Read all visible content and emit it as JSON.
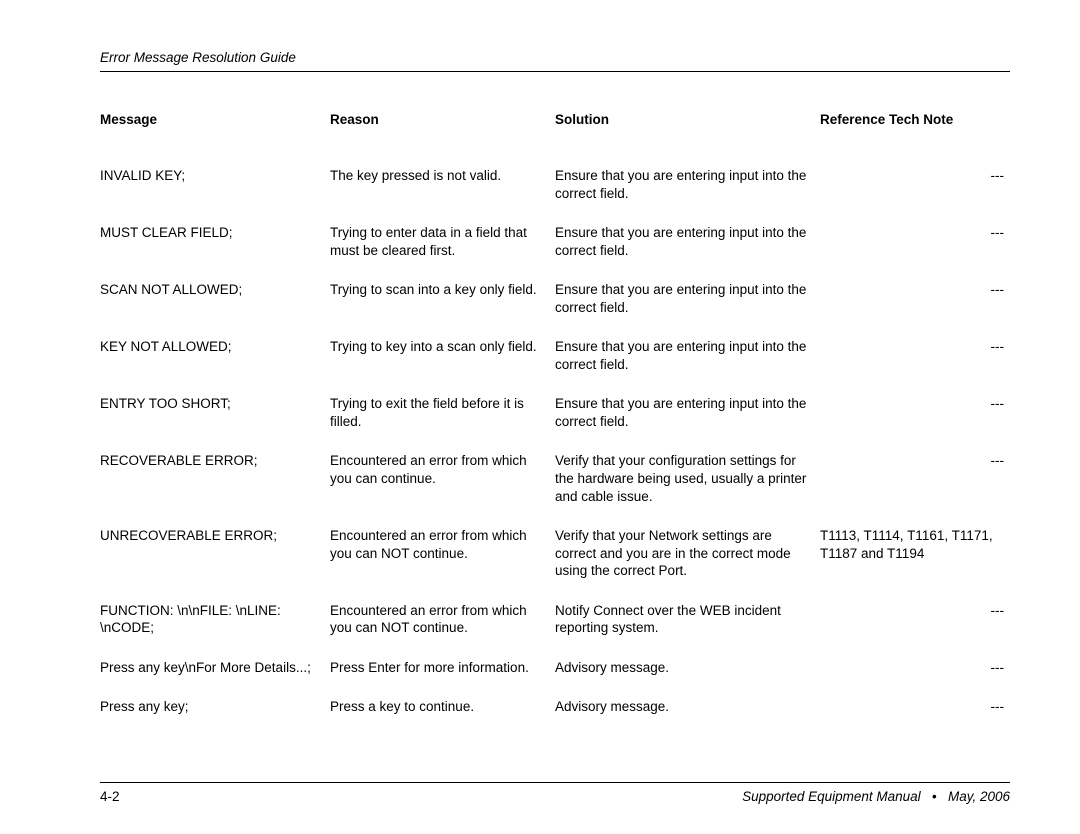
{
  "header": {
    "title": "Error Message Resolution Guide"
  },
  "table": {
    "headers": {
      "message": "Message",
      "reason": "Reason",
      "solution": "Solution",
      "reference": "Reference Tech Note"
    },
    "rows": [
      {
        "message": "INVALID KEY;",
        "reason": "The key pressed is not valid.",
        "solution": "Ensure that you are entering input into the correct field.",
        "reference": "---",
        "ref_has_notes": false
      },
      {
        "message": "MUST CLEAR FIELD;",
        "reason": "Trying to enter data in a field that must be cleared first.",
        "solution": "Ensure that you are entering input into the correct field.",
        "reference": "---",
        "ref_has_notes": false
      },
      {
        "message": "SCAN NOT ALLOWED;",
        "reason": "Trying to scan into a key only field.",
        "solution": "Ensure that you are entering input into the correct field.",
        "reference": "---",
        "ref_has_notes": false
      },
      {
        "message": "KEY NOT ALLOWED;",
        "reason": "Trying to key into a scan only field.",
        "solution": "Ensure that you are entering input into the correct field.",
        "reference": "---",
        "ref_has_notes": false
      },
      {
        "message": "ENTRY TOO SHORT;",
        "reason": "Trying to exit the field before it is filled.",
        "solution": "Ensure that you are entering input into the correct field.",
        "reference": "---",
        "ref_has_notes": false
      },
      {
        "message": "RECOVERABLE ERROR;",
        "reason": "Encountered an error from which you can continue.",
        "solution": "Verify that your configuration settings for the hardware being used, usually a printer and cable issue.",
        "reference": "---",
        "ref_has_notes": false
      },
      {
        "message": "UNRECOVERABLE ERROR;",
        "reason": "Encountered an error from which you can NOT continue.",
        "solution": "Verify that your Network settings are correct and you are in the correct mode using the correct Port.",
        "reference": "T1113, T1114, T1161, T1171, T1187 and T1194",
        "ref_has_notes": true
      },
      {
        "message": "FUNCTION: \\n\\nFILE: \\nLINE: \\nCODE;",
        "reason": "Encountered an error from which you can NOT continue.",
        "solution": "Notify Connect over the WEB incident reporting system.",
        "reference": "---",
        "ref_has_notes": false
      },
      {
        "message": "Press any key\\nFor More Details...;",
        "reason": "Press Enter for more information.",
        "solution": "Advisory message.",
        "reference": "---",
        "ref_has_notes": false
      },
      {
        "message": "Press any key;",
        "reason": "Press a key to continue.",
        "solution": "Advisory message.",
        "reference": "---",
        "ref_has_notes": false
      }
    ]
  },
  "footer": {
    "page_number": "4-2",
    "manual": "Supported Equipment Manual",
    "separator": "•",
    "date": "May, 2006"
  }
}
